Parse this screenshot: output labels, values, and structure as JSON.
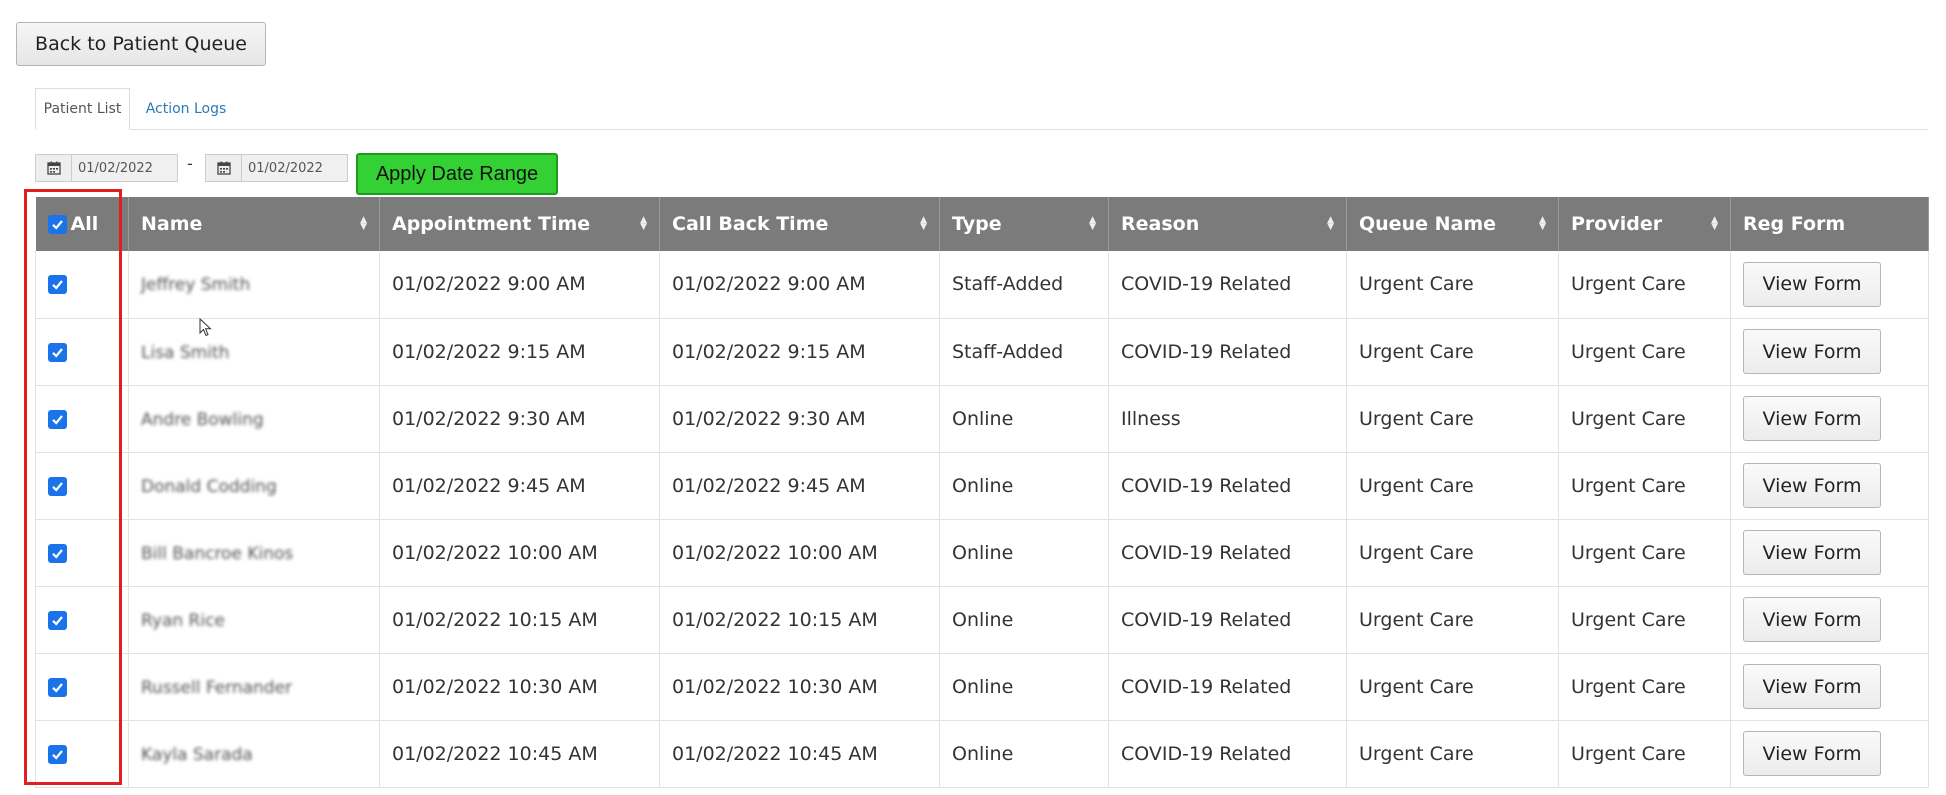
{
  "toolbar": {
    "back_label": "Back to Patient Queue"
  },
  "tabs": [
    {
      "label": "Patient List",
      "active": true
    },
    {
      "label": "Action Logs",
      "active": false
    }
  ],
  "date_range": {
    "start": "01/02/2022",
    "separator": "-",
    "end": "01/02/2022",
    "apply_label": "Apply Date Range",
    "calendar_icon": "calendar-icon"
  },
  "table": {
    "select_all_label": "All",
    "columns": [
      "Name",
      "Appointment Time",
      "Call Back Time",
      "Type",
      "Reason",
      "Queue Name",
      "Provider",
      "Reg Form"
    ],
    "view_label": "View Form",
    "rows": [
      {
        "name": "Jeffrey Smith",
        "appointment": "01/02/2022 9:00 AM",
        "callback": "01/02/2022 9:00 AM",
        "type": "Staff-Added",
        "reason": "COVID-19 Related",
        "queue": "Urgent Care",
        "provider": "Urgent Care"
      },
      {
        "name": "Lisa Smith",
        "appointment": "01/02/2022 9:15 AM",
        "callback": "01/02/2022 9:15 AM",
        "type": "Staff-Added",
        "reason": "COVID-19 Related",
        "queue": "Urgent Care",
        "provider": "Urgent Care"
      },
      {
        "name": "Andre Bowling",
        "appointment": "01/02/2022 9:30 AM",
        "callback": "01/02/2022 9:30 AM",
        "type": "Online",
        "reason": "Illness",
        "queue": "Urgent Care",
        "provider": "Urgent Care"
      },
      {
        "name": "Donald Codding",
        "appointment": "01/02/2022 9:45 AM",
        "callback": "01/02/2022 9:45 AM",
        "type": "Online",
        "reason": "COVID-19 Related",
        "queue": "Urgent Care",
        "provider": "Urgent Care"
      },
      {
        "name": "Bill Bancroe Kinos",
        "appointment": "01/02/2022 10:00 AM",
        "callback": "01/02/2022 10:00 AM",
        "type": "Online",
        "reason": "COVID-19 Related",
        "queue": "Urgent Care",
        "provider": "Urgent Care"
      },
      {
        "name": "Ryan Rice",
        "appointment": "01/02/2022 10:15 AM",
        "callback": "01/02/2022 10:15 AM",
        "type": "Online",
        "reason": "COVID-19 Related",
        "queue": "Urgent Care",
        "provider": "Urgent Care"
      },
      {
        "name": "Russell Fernander",
        "appointment": "01/02/2022 10:30 AM",
        "callback": "01/02/2022 10:30 AM",
        "type": "Online",
        "reason": "COVID-19 Related",
        "queue": "Urgent Care",
        "provider": "Urgent Care"
      },
      {
        "name": "Kayla Sarada",
        "appointment": "01/02/2022 10:45 AM",
        "callback": "01/02/2022 10:45 AM",
        "type": "Online",
        "reason": "COVID-19 Related",
        "queue": "Urgent Care",
        "provider": "Urgent Care"
      }
    ]
  },
  "colors": {
    "header_bg": "#7b7b7b",
    "apply_green": "#34d134",
    "checkbox_blue": "#1a73e8",
    "highlight_red": "#e02020",
    "link_blue": "#2a7ab8"
  }
}
